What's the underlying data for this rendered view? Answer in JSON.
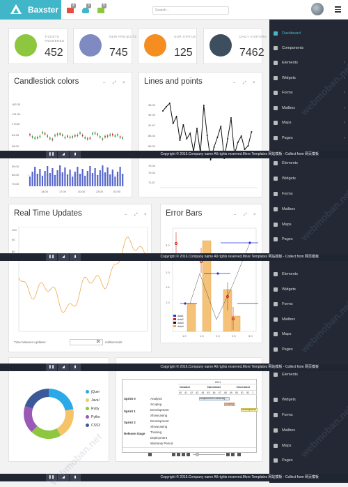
{
  "app": {
    "brand": "Baxster",
    "search_placeholder": "Search..."
  },
  "topbar": {
    "badges": [
      "4",
      "3",
      "9"
    ]
  },
  "stats": [
    {
      "label": "TICKETS ANSWERED",
      "value": "452",
      "color": "#8dc63f",
      "icon": "ticket-icon"
    },
    {
      "label": "NEW PROJECTS",
      "value": "745",
      "color": "#7e8ac1",
      "icon": "rocket-icon"
    },
    {
      "label": "OUR STATUS",
      "value": "125",
      "color": "#f58d21",
      "icon": "status-icon"
    },
    {
      "label": "DAILY VISITORS",
      "value": "7462",
      "color": "#3d4f5f",
      "icon": "visitors-icon"
    }
  ],
  "sidebar": {
    "items": [
      {
        "label": "Dashboard",
        "icon": "home-icon"
      },
      {
        "label": "Components",
        "icon": "cogs-icon"
      },
      {
        "label": "Elements",
        "icon": "grid-icon"
      },
      {
        "label": "Widgets",
        "icon": "widgets-icon"
      },
      {
        "label": "Forms",
        "icon": "forms-icon"
      },
      {
        "label": "Mailbox",
        "icon": "mail-icon"
      },
      {
        "label": "Maps",
        "icon": "map-icon"
      },
      {
        "label": "Pages",
        "icon": "pages-icon"
      }
    ],
    "repeat_items": [
      "Elements",
      "Widgets",
      "Forms",
      "Mailbox",
      "Maps",
      "Pages"
    ]
  },
  "panels": {
    "candlestick": {
      "title": "Candlestick colors",
      "yticks": [
        "182.33",
        "131.00",
        "174.67",
        "83.33",
        "58.00",
        "95.00",
        "85.00",
        "75.00"
      ],
      "xticks": [
        "14:00",
        "17:00",
        "20:00",
        "23:00",
        "02:00"
      ]
    },
    "lines": {
      "title": "Lines and points",
      "yticks": [
        "98.33",
        "94.00",
        "91.67",
        "88.33",
        "85.00",
        "78.33",
        "75.00",
        "71.67"
      ]
    },
    "realtime": {
      "title": "Real Time Updates",
      "yticks": [
        "100",
        "90",
        "80"
      ],
      "update_label": "Time between updates:",
      "update_value": "30",
      "update_unit": "milliseconds"
    },
    "errorbars": {
      "title": "Error Bars",
      "yticks": [
        "3.0",
        "2.5",
        "2.0",
        "1.5",
        "1.0"
      ],
      "xticks": [
        "1.0",
        "1.5",
        "2.0",
        "2.5",
        "3.0"
      ],
      "legend": [
        "data1",
        "data2",
        "data3",
        "data4"
      ]
    },
    "donut": {
      "legend": [
        "jQuer",
        "Java!",
        "Ruby",
        "Pytho",
        "CSS3"
      ],
      "colors": [
        "#2aa8e8",
        "#f5c36a",
        "#8dc63f",
        "#9b59b6",
        "#3b5998"
      ]
    },
    "gantt": {
      "year": "2011",
      "months": [
        "October",
        "November",
        "December"
      ],
      "days": [
        "40",
        "41",
        "42",
        "43",
        "44",
        "45",
        "46",
        "47",
        "48",
        "49",
        "50",
        "51",
        "52",
        "1"
      ],
      "sprints": [
        "Sprint 0",
        "Sprint 1",
        "Sprint 2",
        "Release Stage"
      ],
      "tasks": [
        "Analysis",
        "Scoping",
        "Development",
        "Showcasing",
        "Development",
        "Showcasing",
        "Training",
        "Deployment",
        "Warranty Period"
      ],
      "bars": [
        "Requirement Gathering",
        "Scoping",
        "Development"
      ]
    }
  },
  "footer": {
    "text": "Copyright © 2016.Company name All rights reserved.More Templates 网站模板 - Collect from 网页模板"
  },
  "watermark": "webmoban.net"
}
